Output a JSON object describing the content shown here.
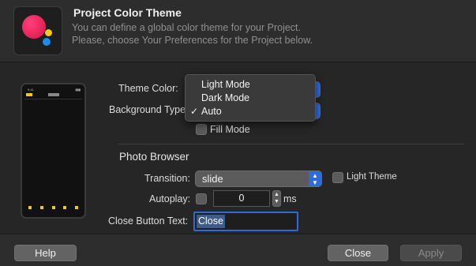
{
  "header": {
    "title": "Project Color Theme",
    "desc_line1": "You can define a global color theme for your Project.",
    "desc_line2": "Please, choose Your Preferences for the Project below."
  },
  "preview": {
    "status_time": "9:41",
    "status_right": "▮▮▮"
  },
  "theme": {
    "theme_color_label": "Theme Color:",
    "background_type_label": "Background Type:",
    "menu_options": [
      "Light Mode",
      "Dark Mode",
      "Auto"
    ],
    "selected_option": "Auto",
    "check_mark": "✓",
    "fill_mode_label": "Fill Mode",
    "fill_mode_checked": false
  },
  "photo_browser": {
    "section_title": "Photo Browser",
    "transition_label": "Transition:",
    "transition_value": "slide",
    "light_theme_label": "Light Theme",
    "light_theme_checked": false,
    "autoplay_label": "Autoplay:",
    "autoplay_checked": false,
    "autoplay_value": "0",
    "autoplay_unit": "ms",
    "close_button_text_label": "Close Button Text:",
    "close_button_text_value": "Close"
  },
  "footer": {
    "help_label": "Help",
    "close_label": "Close",
    "apply_label": "Apply"
  },
  "colors": {
    "accent": "#2d6bdd",
    "background": "#262626"
  }
}
